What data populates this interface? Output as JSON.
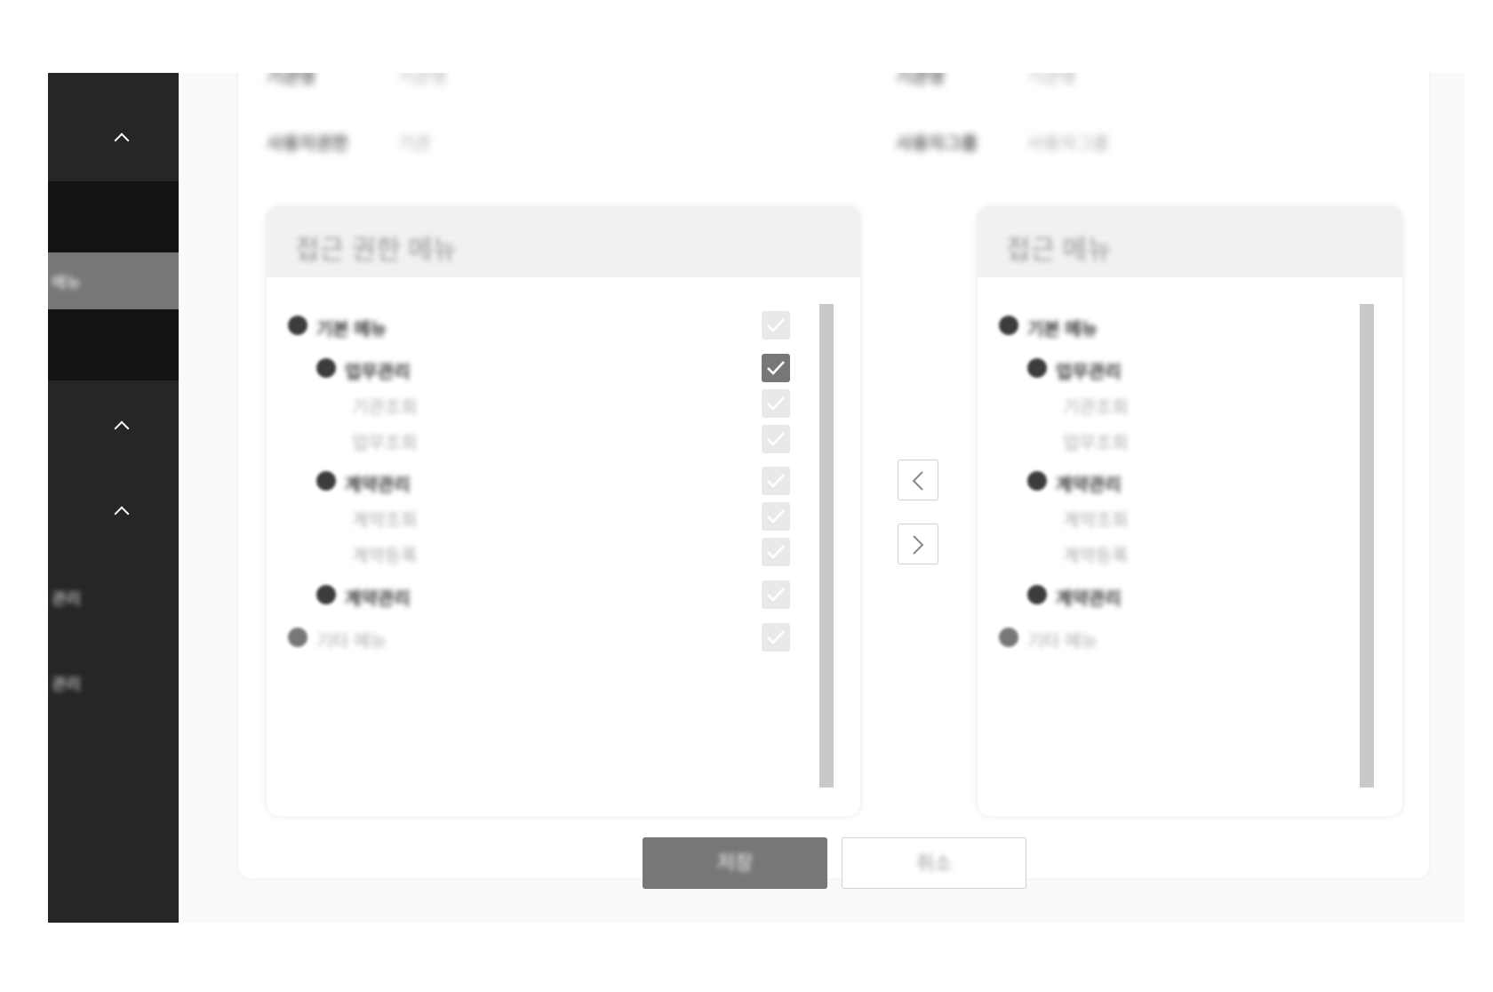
{
  "sidebar": {
    "items": [
      {
        "label": "",
        "icon": "chevron-up-icon"
      },
      {
        "label": ""
      },
      {
        "label": "메뉴"
      },
      {
        "label": ""
      },
      {
        "label": "",
        "icon": "chevron-up-icon"
      },
      {
        "label": "",
        "icon": "chevron-up-icon"
      },
      {
        "label": "관리"
      },
      {
        "label": "관리"
      }
    ]
  },
  "info": {
    "row1_label_left": "기관명",
    "row1_value_left": "기관명",
    "row1_label_right": "기관명",
    "row1_value_right": "기관명",
    "row2_label_left": "사용자권한",
    "row2_value_left": "기관",
    "row2_label_right": "사용자그룹",
    "row2_value_right": "사용자그룹"
  },
  "left_panel": {
    "title": "접근 권한 메뉴",
    "items": [
      {
        "label": "기본 메뉴",
        "level": 0,
        "bullet": true,
        "checked": false
      },
      {
        "label": "업무관리",
        "level": 1,
        "bullet": true,
        "checked": true
      },
      {
        "label": "기관조회",
        "level": 2,
        "bullet": false,
        "checked": false
      },
      {
        "label": "업무조회",
        "level": 2,
        "bullet": false,
        "checked": false
      },
      {
        "label": "계약관리",
        "level": 1,
        "bullet": true,
        "checked": false
      },
      {
        "label": "계약조회",
        "level": 2,
        "bullet": false,
        "checked": false
      },
      {
        "label": "계약등록",
        "level": 2,
        "bullet": false,
        "checked": false
      },
      {
        "label": "계약관리",
        "level": 1,
        "bullet": true,
        "checked": false
      },
      {
        "label": "기타 메뉴",
        "level": 0,
        "bullet": true,
        "checked": false
      }
    ]
  },
  "right_panel": {
    "title": "접근 메뉴",
    "items": [
      {
        "label": "기본 메뉴",
        "level": 0,
        "bullet": true
      },
      {
        "label": "업무관리",
        "level": 1,
        "bullet": true
      },
      {
        "label": "기관조회",
        "level": 2,
        "bullet": false
      },
      {
        "label": "업무조회",
        "level": 2,
        "bullet": false
      },
      {
        "label": "계약관리",
        "level": 1,
        "bullet": true
      },
      {
        "label": "계약조회",
        "level": 2,
        "bullet": false
      },
      {
        "label": "계약등록",
        "level": 2,
        "bullet": false
      },
      {
        "label": "계약관리",
        "level": 1,
        "bullet": true
      },
      {
        "label": "기타 메뉴",
        "level": 0,
        "bullet": true
      }
    ]
  },
  "transfer": {
    "left_icon": "chevron-left-icon",
    "right_icon": "chevron-right-icon"
  },
  "buttons": {
    "save_label": "저장",
    "cancel_label": "취소"
  },
  "colors": {
    "sidebar_bg": "#262626",
    "sidebar_active": "#777777",
    "primary_button": "#777777"
  }
}
